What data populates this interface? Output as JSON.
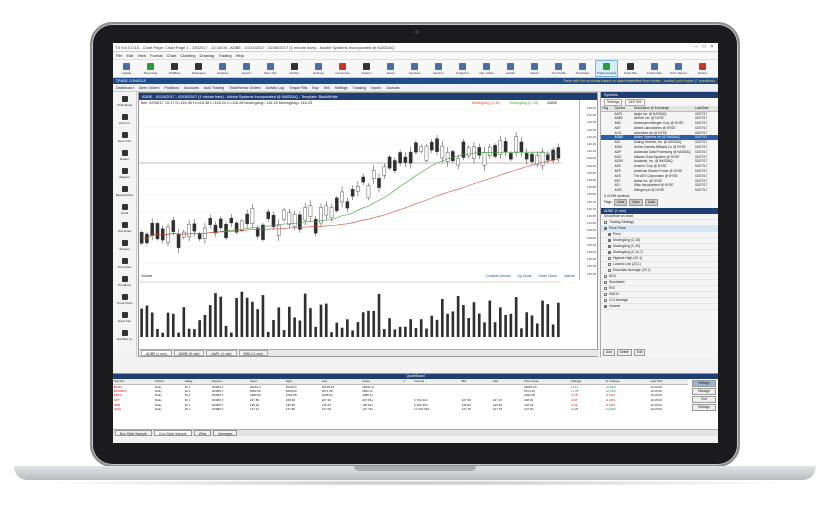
{
  "window": {
    "title": "TS 9.6.0.0.14 - Chart Page: Chart Page 1 - 2/8/2017 - 10:18:05 - ADBE - 01/24/2017 - 02/08/2017 (1 minute bars) - Adobe Systems Incorporated @ NASDAQ"
  },
  "menu": [
    "File",
    "Edit",
    "View",
    "Format",
    "Chart",
    "Charting",
    "Drawing",
    "Trading",
    "Help"
  ],
  "toolbar": [
    {
      "label": "Update",
      "icon": "cloud-icon"
    },
    {
      "label": "Streaming",
      "icon": "wifi-icon"
    },
    {
      "label": "TickBars",
      "icon": "wrench-icon"
    },
    {
      "label": "Strategies",
      "icon": "gear-icon"
    },
    {
      "label": "Libraries",
      "icon": "book-icon"
    },
    {
      "label": "Export",
      "icon": "export-icon"
    },
    {
      "label": "Sent. Rpt.",
      "icon": "chart-icon"
    },
    {
      "label": "Hill Rpt.",
      "icon": "cross-icon"
    },
    {
      "label": "Settings",
      "icon": "settings-icon"
    },
    {
      "label": "Customize",
      "icon": "palette-icon"
    },
    {
      "label": "System",
      "icon": "system-icon"
    },
    {
      "label": "Alerts",
      "icon": "bell-icon"
    },
    {
      "label": "Symbols",
      "icon": "symbol-icon"
    },
    {
      "label": "Sectors",
      "icon": "sectors-icon"
    },
    {
      "label": "Snapshot",
      "icon": "camera-icon"
    },
    {
      "label": "Opt. Chain",
      "icon": "chain-icon"
    },
    {
      "label": "Ladder",
      "icon": "ladder-icon"
    },
    {
      "label": "Depth",
      "icon": "depth-icon"
    },
    {
      "label": "Trd. Profile",
      "icon": "profile-icon"
    },
    {
      "label": "TimeSales",
      "icon": "clock-icon"
    },
    {
      "label": "Trade Console",
      "icon": "console-icon"
    },
    {
      "label": "Order Bar",
      "icon": "orderbar-icon"
    },
    {
      "label": "Trade Filter",
      "icon": "filter-icon"
    },
    {
      "label": "Perf. Report",
      "icon": "report-icon"
    },
    {
      "label": "Orders",
      "icon": "orders-icon"
    }
  ],
  "console": {
    "title": "TRADE CONSOLE",
    "message": "Trade with live accounts based on data transmitted from broker - contact your broker (? questions)"
  },
  "subtoolbar": [
    "Dashboard",
    "Open Orders",
    "Positions",
    "Accounts",
    "Auto Trading",
    "TradeSense Orders",
    "Activity Log",
    "Torque Fills",
    "Buy",
    "Sell",
    "Settings",
    "Tracking",
    "Inputs",
    "Journals"
  ],
  "lefttools": [
    "Chart Book",
    "Zoom In",
    "Zoom Out",
    "Eraser",
    "Magnet",
    "Repeat Draw",
    "Grids",
    "Text Draw",
    "Shapes",
    "Price Alert",
    "TrendLine",
    "Trend Chan",
    "Gann Fan",
    "Sup/Res Ln"
  ],
  "chart": {
    "header": "ADBE - 01/24/2017 - 02/08/2017 (1 minute bars) - Adobe Systems Incorporated @ NASDAQ - Template: BlackWhite",
    "ohlc": "Bar: 02/08/17 10:17  O=116.35  H=116.38  L=116.24  C=116.28  MovingAvg= 116.25  MovingAvg= 116.23",
    "legend": [
      "MovingAvg (C,40)",
      "MovingAvg (C,15)",
      "ADBE"
    ],
    "volume_label": "Volume",
    "volume_legend": [
      "Contract Volume",
      "Up Close",
      "Down Close",
      "Volume"
    ],
    "price_ticks": [
      "116.40",
      "116.35",
      "116.30",
      "116.25",
      "116.20",
      "116.15",
      "116.10",
      "116.05",
      "116.00",
      "115.95",
      "115.90",
      "115.85",
      "115.80",
      "115.75",
      "115.70",
      "115.65",
      "115.60",
      "115.55",
      "115.50",
      "115.45",
      "115.40",
      "115.35",
      "115.30",
      "115.25"
    ],
    "tabs": [
      "ADBE (1 min)",
      "ADBE (5 min)",
      "AAPL (1 min)",
      "BIDU (1 min)"
    ],
    "colors": {
      "ma_long": "#d6483a",
      "ma_short": "#3f9a3c",
      "up_bar": "#ffffff",
      "down_bar": "#2f2f2f",
      "volume": "#2f2f2f"
    }
  },
  "symbols": {
    "header": "Symbols",
    "list_label": "Settings",
    "list_value": "S&P 500",
    "columns": [
      "Flag",
      "Symbol",
      "Description @ Exchange",
      "Last/Date"
    ],
    "rows": [
      [
        "",
        "AAPL",
        "Apple Inc. @ NASDAQ",
        "02/07/17"
      ],
      [
        "",
        "ABBV",
        "AbbVie Inc. @ NYSE",
        "02/07/17"
      ],
      [
        "",
        "ABC",
        "AmerisourceBergen Corp @ NYSE",
        "02/07/17"
      ],
      [
        "",
        "ABT",
        "Abbott Laboratories @ NYSE",
        "02/07/17"
      ],
      [
        "",
        "ACN",
        "Accenture plc @ NYSE",
        "02/07/17"
      ],
      [
        "",
        "ADBE",
        "Adobe Systems Inc @ NASDAQ",
        "02/07/17"
      ],
      [
        "",
        "ADI",
        "Analog Devices, Inc. @ NASDAQ",
        "02/07/17"
      ],
      [
        "",
        "ADM",
        "Archer-Daniels-Midland Co @ NYSE",
        "02/07/17"
      ],
      [
        "",
        "ADP",
        "Automatic Data Processing @ NASDAQ",
        "02/07/17"
      ],
      [
        "",
        "ADS",
        "Alliance Data Systems @ NYSE",
        "02/07/17"
      ],
      [
        "",
        "ADSK",
        "Autodesk, Inc. @ NASDAQ",
        "02/07/17"
      ],
      [
        "",
        "AEE",
        "Ameren Corp @ NYSE",
        "02/07/17"
      ],
      [
        "",
        "AEP",
        "American Electric Power @ NYSE",
        "02/07/17"
      ],
      [
        "",
        "AES",
        "The AES Corporation @ NYSE",
        "02/07/17"
      ],
      [
        "",
        "AET",
        "Aetna Inc. @ NYSE",
        "02/07/17"
      ],
      [
        "",
        "AFL",
        "Aflac Incorporated @ NYSE",
        "02/07/17"
      ],
      [
        "",
        "AGN",
        "Allergan plc @ NYSE",
        "02/07/17"
      ]
    ],
    "count": "5 of 499 symbols",
    "flags_label": "Flags",
    "flag_buttons": [
      "Clear",
      "Save",
      "Load"
    ]
  },
  "indicators": {
    "header": "ADBE (1 min)",
    "title": "Show/hide on chart",
    "items": [
      {
        "label": "Trading Strategy",
        "on": false
      },
      {
        "label": "Price Pane",
        "on": true
      },
      {
        "label": "Price",
        "on": true
      },
      {
        "label": "MovingAvg (C,15)",
        "on": true
      },
      {
        "label": "MovingAvg (C,40)",
        "on": true
      },
      {
        "label": "MovingAvg (C,14,7)",
        "on": true
      },
      {
        "label": "Highest High (20,1)",
        "on": false
      },
      {
        "label": "Lowest Low (20,1)",
        "on": false
      },
      {
        "label": "Donchian Average (20,1)",
        "on": false
      },
      {
        "label": "ADX",
        "on": false
      },
      {
        "label": "Stochastic",
        "on": false
      },
      {
        "label": "RSI",
        "on": false
      },
      {
        "label": "MACD",
        "on": false
      },
      {
        "label": "CCI Average",
        "on": false
      },
      {
        "label": "Volume",
        "on": true
      }
    ],
    "buttons": [
      "Add",
      "Delete",
      "Edit"
    ]
  },
  "quoteboard": {
    "header": "QuoteBoard",
    "columns": [
      "Symbol",
      "Period",
      "Delay",
      "Session",
      "Open",
      "High",
      "Low",
      "Close",
      "Y",
      "Volume",
      "Bid",
      "Ask",
      "Prev Close",
      "Change",
      "% Change",
      "Last Tick"
    ],
    "rows": [
      [
        "$DJIA",
        "Daily",
        "Rt 1",
        "02/08/17",
        "20091.0",
        "20118.0",
        "20078.15",
        "20094.4+",
        "",
        "",
        "",
        "",
        "20090.29",
        "+4.11",
        "+0.02%",
        "10:18:00"
      ],
      [
        "$COMPX",
        "Daily",
        "Rt 1",
        "02/08/17",
        "5682.96",
        "5689.80",
        "5671.08",
        "5682.0+",
        "",
        "",
        "",
        "",
        "5674.22",
        "+7.78",
        "+0.14%",
        "10:18:00"
      ],
      [
        "$SPX",
        "Daily",
        "Rt 1",
        "02/08/17",
        "2289.59",
        "2291.88",
        "2285.54",
        "2288.3+",
        "",
        "",
        "",
        "",
        "2293.08",
        "-4.78",
        "-0.21%",
        "10:18:00"
      ],
      [
        "SPY",
        "Daily",
        "Rt 1",
        "02/08/17",
        "227.89",
        "228.48",
        "227.36",
        "227.96+",
        "",
        "2,764,121",
        "227.96",
        "227.97",
        "228.93",
        "-0.97",
        "-0.42%",
        "10:18:00"
      ],
      [
        "IWM",
        "Daily",
        "Rt 1",
        "02/08/17",
        "135.46",
        "135.95",
        "135.25",
        "135.82+",
        "",
        "2,301,554",
        "135.82",
        "135.83",
        "136.04",
        "-0.22",
        "-0.16%",
        "10:18:00"
      ],
      [
        "QQQ",
        "Daily",
        "Rt 1",
        "02/08/17",
        "127.41",
        "127.86",
        "127.28",
        "127.78+",
        "",
        "17,262,064",
        "127.78",
        "127.79",
        "127.50",
        "+0.28",
        "+0.22%",
        "10:18:00"
      ]
    ],
    "side_buttons": [
      "Settings",
      "Manage",
      "Sort",
      "Settings"
    ]
  },
  "bottom_tabs": [
    "Box Style Sample",
    "Cool Style Sample",
    "Wins",
    "Averages"
  ]
}
